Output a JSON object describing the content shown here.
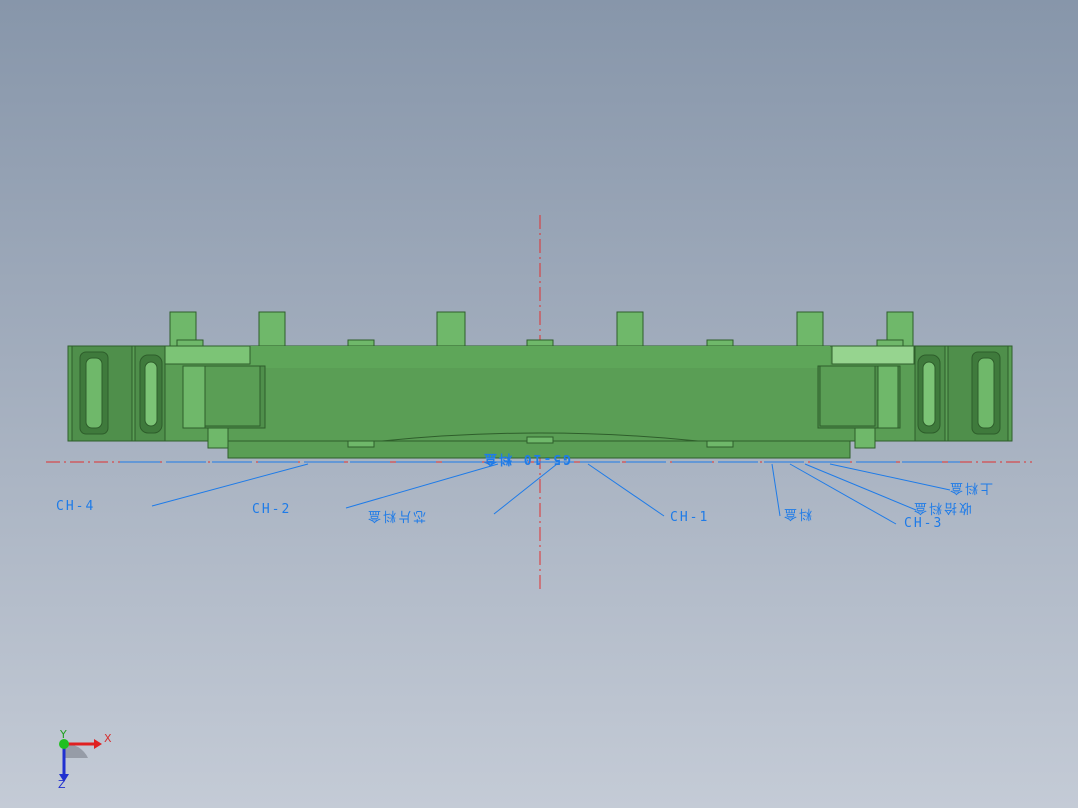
{
  "view": {
    "annotations": {
      "ch4": "CH-4",
      "ch2": "CH-2",
      "ch1": "CH-1",
      "ch3": "CH-3",
      "label_flipped_1": "芯片料盒",
      "label_flipped_2": "G5-10 料盒",
      "label_flipped_3": "料盒",
      "label_flipped_4": "收拾料盒",
      "label_flipped_5": "上料盒"
    },
    "triad": {
      "x": "X",
      "y": "Y",
      "z": "Z"
    },
    "colors": {
      "part_body": "#5a9e55",
      "part_dark": "#3f7a3c",
      "part_light": "#8ccf86",
      "centerline": "#e03030",
      "annotation": "#1e7be8"
    }
  }
}
